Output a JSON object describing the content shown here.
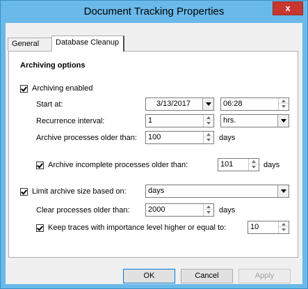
{
  "window": {
    "title": "Document Tracking Properties",
    "close_glyph": "x"
  },
  "tabs": [
    {
      "label": "General",
      "active": false
    },
    {
      "label": "Database Cleanup",
      "active": true
    }
  ],
  "archiving": {
    "section_title": "Archiving options",
    "enabled_label": "Archiving enabled",
    "enabled_checked": true,
    "start_at_label": "Start at:",
    "start_date": "3/13/2017",
    "start_time": "06:28",
    "recurrence_label": "Recurrence interval:",
    "recurrence_value": "1",
    "recurrence_unit": "hrs.",
    "older_than_label": "Archive processes older than:",
    "older_than_value": "100",
    "older_than_unit": "days",
    "incomplete_label": "Archive incomplete processes older than:",
    "incomplete_checked": true,
    "incomplete_value": "101",
    "incomplete_unit": "days"
  },
  "limit": {
    "label": "Limit archive size based on:",
    "checked": true,
    "mode_value": "days",
    "clear_label": "Clear processes older than:",
    "clear_value": "2000",
    "clear_unit": "days",
    "keep_traces_label": "Keep traces with importance level higher or equal to:",
    "keep_traces_checked": true,
    "keep_traces_value": "10"
  },
  "buttons": {
    "ok": "OK",
    "cancel": "Cancel",
    "apply": "Apply"
  }
}
